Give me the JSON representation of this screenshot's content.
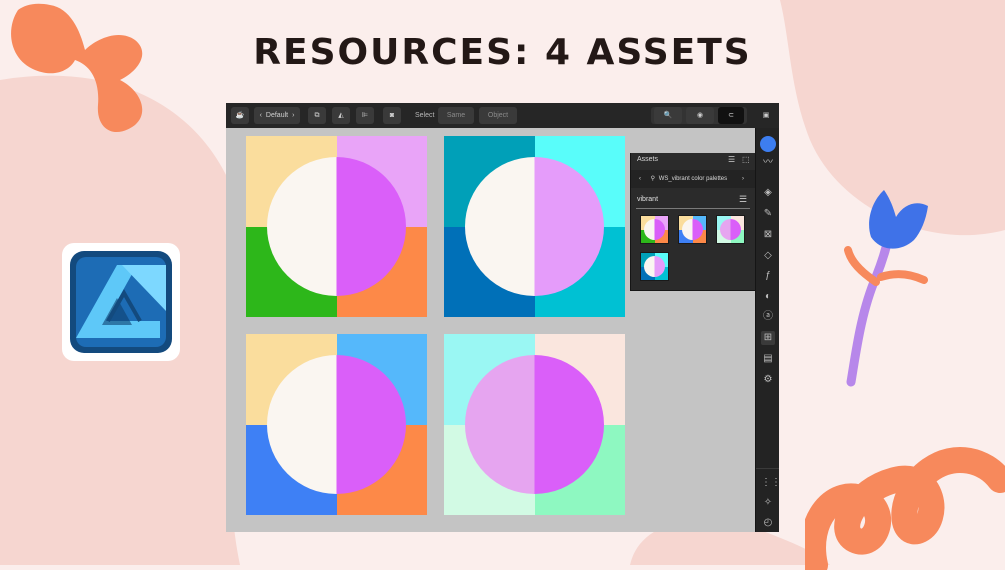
{
  "page": {
    "title": "RESOURCES: 4 ASSETS"
  },
  "colors": {
    "background": "#fbeeec",
    "blob_pink": "#f6d6d0",
    "orange": "#f7895c",
    "flower_blue": "#3f72e8",
    "flower_stem": "#b787ea",
    "accent_blue": "#3d7ef0"
  },
  "app_icon": {
    "name": "affinity-designer-logo-icon"
  },
  "toolbar": {
    "persona_icon": "designer-persona-icon",
    "workspace_label": "Default",
    "select_label": "Select",
    "same_label": "Same",
    "object_label": "Object"
  },
  "assets_panel": {
    "title": "Assets",
    "crumb": "WS_vibrant color palettes",
    "category": "vibrant"
  },
  "artworks": [
    {
      "name": "palette-yellow-purple",
      "tl": "#fadd9d",
      "tr": "#e9a4f8",
      "bl": "#2db71a",
      "br": "#fd8948",
      "left_half": "#faf6f1",
      "right_half": "#da5ff9"
    },
    {
      "name": "palette-teal-cyan",
      "tl": "#00a0b8",
      "tr": "#59fdfa",
      "bl": "#0070b8",
      "br": "#00c1d3",
      "left_half": "#faf6f1",
      "right_half": "#e59cfa"
    },
    {
      "name": "palette-yellow-blue",
      "tl": "#fadd9d",
      "tr": "#55b8fb",
      "bl": "#3e80f5",
      "br": "#fd8948",
      "left_half": "#faf6f1",
      "right_half": "#da5ff9"
    },
    {
      "name": "palette-mint-pink",
      "tl": "#9af7f3",
      "tr": "#fae6de",
      "bl": "#d2fae4",
      "br": "#8ef8c1",
      "left_half": "#e6a5f0",
      "right_half": "#da5ff9"
    }
  ]
}
